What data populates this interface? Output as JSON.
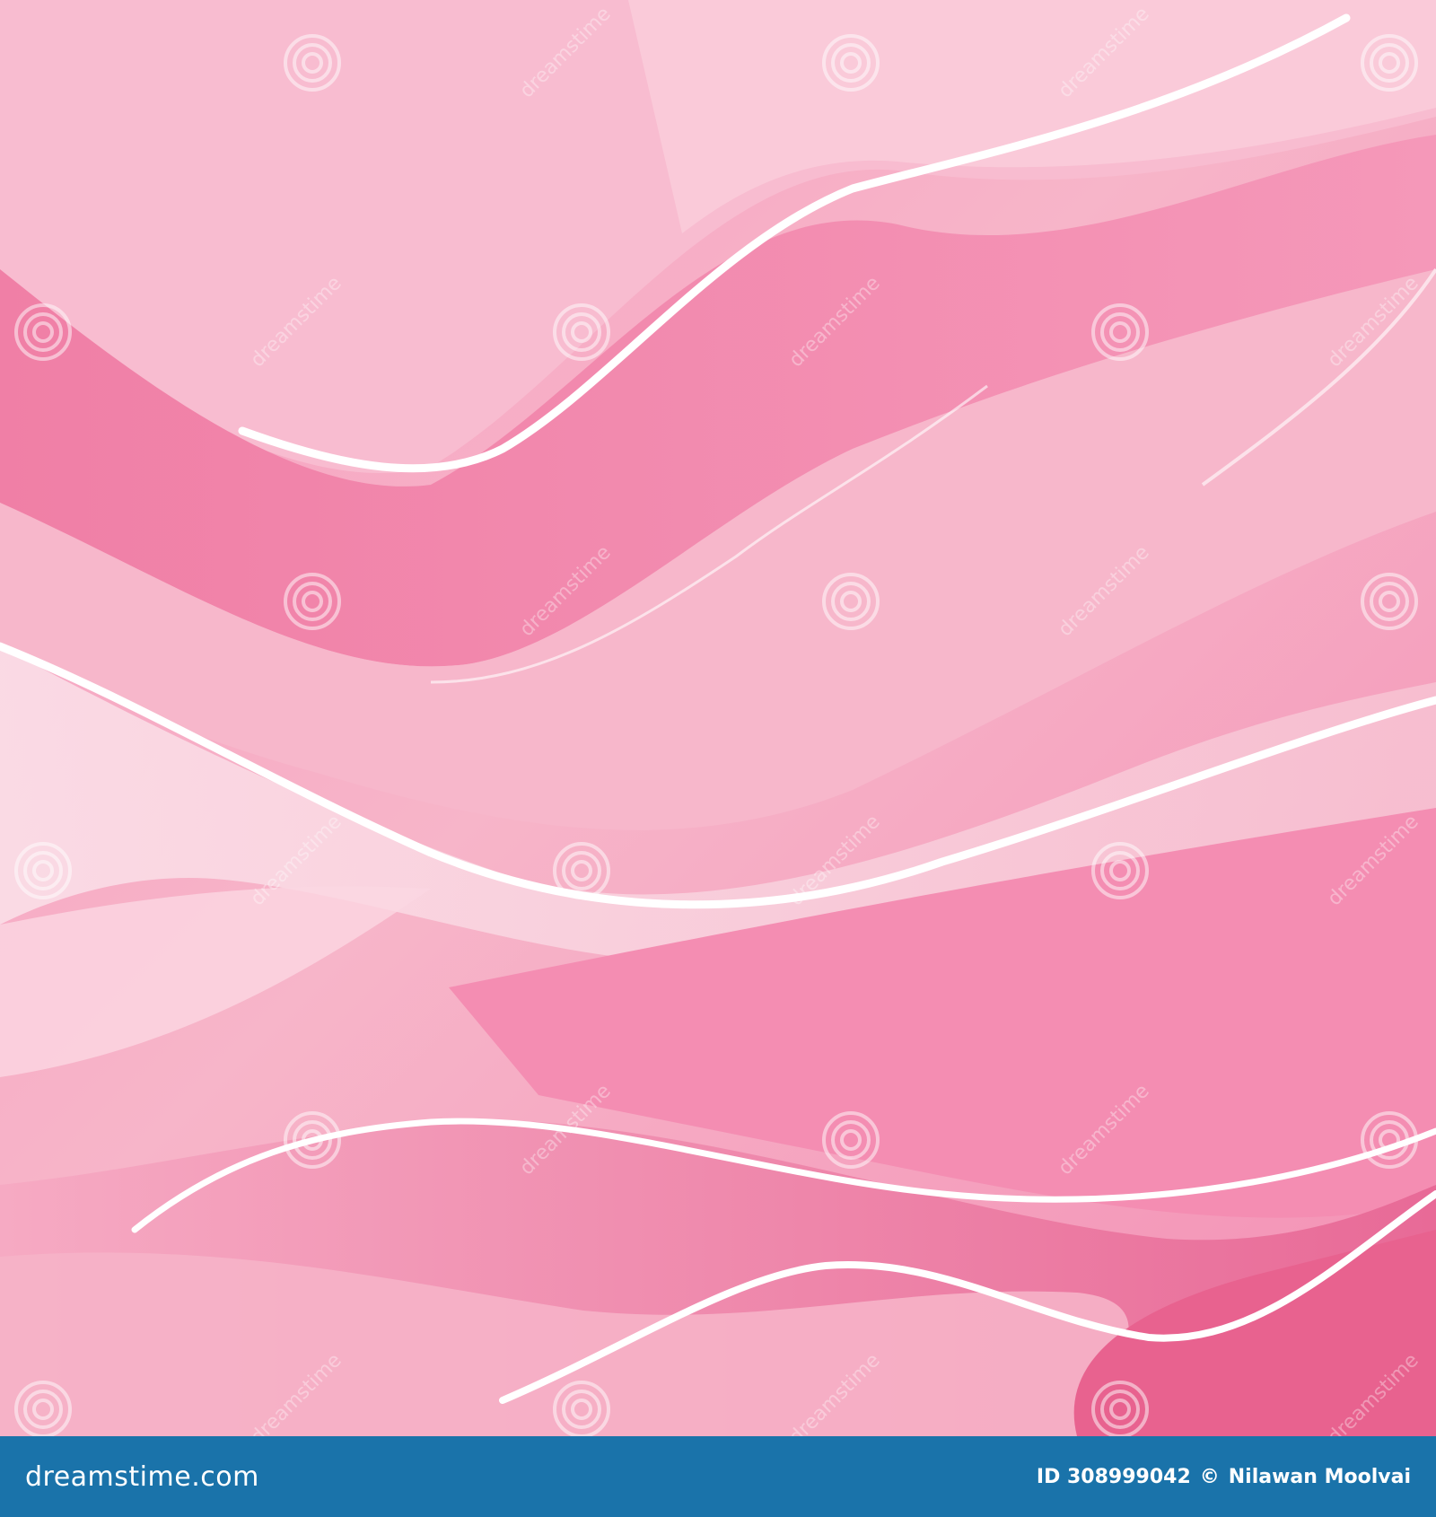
{
  "watermark": {
    "text": "dreamstime",
    "icon": "dreamstime-swirl-icon"
  },
  "footer": {
    "logo_text": "dreamstime.com",
    "image_id": "ID 308999042",
    "copyright_symbol": "©",
    "author": "Nilawan Moolvai"
  },
  "colors": {
    "background_pink": "#f4b6c9",
    "deep_pink": "#f27fa8",
    "footer_blue": "#1a73aa"
  }
}
